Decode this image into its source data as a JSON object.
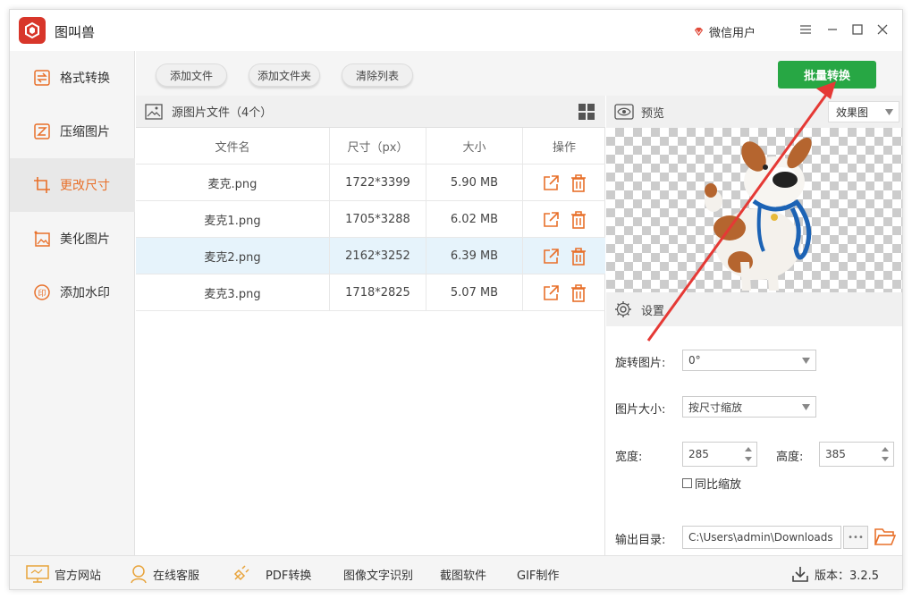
{
  "app": {
    "title": "图叫兽",
    "user_label": "微信用户"
  },
  "sidebar": {
    "items": [
      {
        "label": "格式转换",
        "icon": "format-convert-icon"
      },
      {
        "label": "压缩图片",
        "icon": "compress-icon"
      },
      {
        "label": "更改尺寸",
        "icon": "resize-icon",
        "active": true
      },
      {
        "label": "美化图片",
        "icon": "beautify-icon"
      },
      {
        "label": "添加水印",
        "icon": "watermark-icon"
      }
    ]
  },
  "toolbar": {
    "add_file": "添加文件",
    "add_folder": "添加文件夹",
    "clear_list": "清除列表",
    "batch_convert": "批量转换"
  },
  "file_list": {
    "title": "源图片文件（4个）",
    "columns": [
      "文件名",
      "尺寸（px）",
      "大小",
      "操作"
    ],
    "rows": [
      {
        "name": "麦克.png",
        "dims": "1722*3399",
        "size": "5.90 MB"
      },
      {
        "name": "麦克1.png",
        "dims": "1705*3288",
        "size": "6.02 MB"
      },
      {
        "name": "麦克2.png",
        "dims": "2162*3252",
        "size": "6.39 MB"
      },
      {
        "name": "麦克3.png",
        "dims": "1718*2825",
        "size": "5.07 MB"
      }
    ]
  },
  "preview": {
    "title": "预览",
    "mode": "效果图"
  },
  "settings": {
    "title": "设置",
    "rotate_label": "旋转图片:",
    "rotate_value": "0°",
    "size_label": "图片大小:",
    "size_value": "按尺寸缩放",
    "width_label": "宽度:",
    "width_value": "285",
    "height_label": "高度:",
    "height_value": "385",
    "proportional_label": "同比缩放",
    "output_label": "输出目录:",
    "output_value": "C:\\Users\\admin\\Downloads",
    "browse": "•••"
  },
  "bottom": {
    "official_site": "官方网站",
    "online_service": "在线客服",
    "pdf_convert": "PDF转换",
    "ocr": "图像文字识别",
    "screenshot": "截图软件",
    "gif": "GIF制作",
    "version": "版本：3.2.5"
  },
  "colors": {
    "accent": "#e8702a",
    "brand": "#d8362a",
    "primary_button": "#27a744",
    "selected_row": "#e6f3fb",
    "annotation_arrow": "#e53935"
  }
}
